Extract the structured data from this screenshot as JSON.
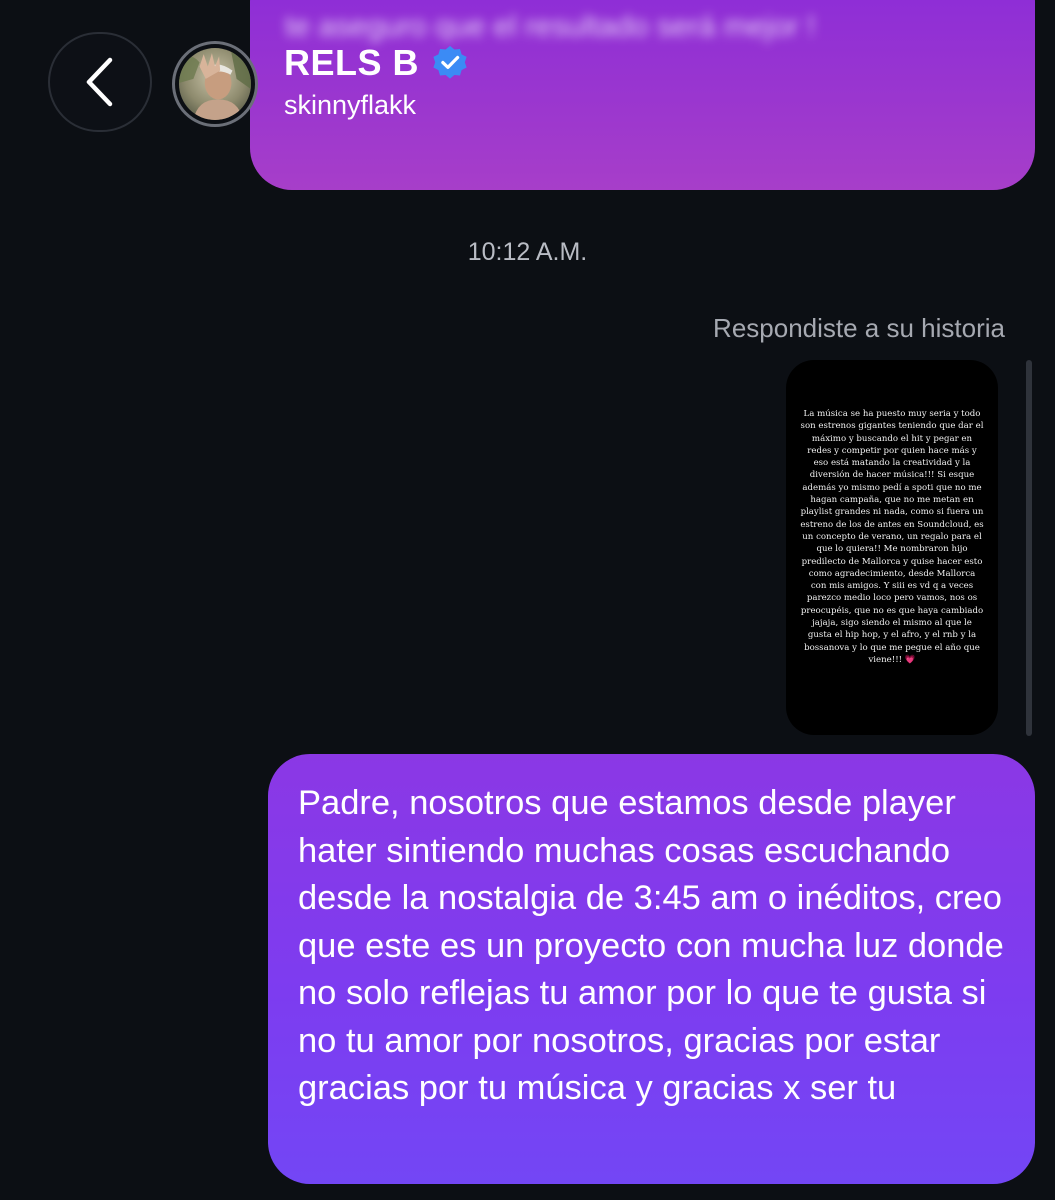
{
  "header": {
    "name": "RELS B",
    "username": "skinnyflakk",
    "verified_color": "#3b8bf5"
  },
  "previous_message": {
    "text": "te aseguro que el resultado será mejor !"
  },
  "timestamp": "10:12 A.M.",
  "story_reply": {
    "label": "Respondiste a su historia",
    "story_text": "La música se ha puesto muy seria y todo son estrenos gigantes teniendo que dar el máximo y buscando el hit y pegar en redes y competir por quien hace más y eso está matando la creatividad y la diversión de hacer música!!! Si esque además yo mismo pedí a spoti que no me hagan campaña, que no me metan en playlist grandes ni nada, como si fuera un estreno de los de antes en Soundcloud, es un concepto de verano, un regalo para el que lo quiera!! Me nombraron hijo predilecto de Mallorca y quise hacer esto como agradecimiento, desde Mallorca con mis amigos. Y siii es vd q  a veces parezco medio loco pero vamos, nos os preocupéis, que no es que haya cambiado jajaja, sigo siendo el mismo al que le gusta el hip hop, y el afro, y el rnb y la bossanova y lo que me pegue el año que viene!!!",
    "story_emoji": "💗"
  },
  "message": {
    "text": "Padre, nosotros que estamos desde player hater sintiendo muchas cosas escuchando desde la nostalgia de 3:45 am o  inéditos, creo que este es un proyecto con mucha luz donde no solo reflejas tu amor por lo que te gusta si no tu amor por nosotros, gracias por estar gracias por tu música y gracias x ser tu"
  },
  "colors": {
    "background": "#0c0f14",
    "bubble_top": "#8b38e5",
    "bubble_bottom": "#7346f5"
  },
  "icons": {
    "back": "chevron-left-icon",
    "verified": "verified-badge-icon"
  }
}
